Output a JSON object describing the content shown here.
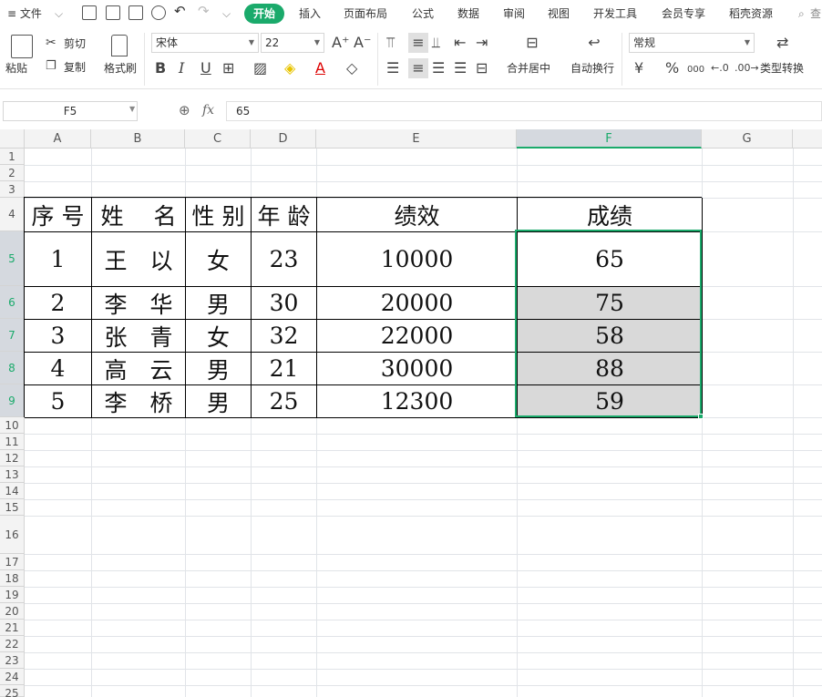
{
  "menubar": {
    "file_menu": "≡ 文件",
    "tabs": [
      "开始",
      "插入",
      "页面布局",
      "公式",
      "数据",
      "审阅",
      "视图",
      "开发工具",
      "会员专享",
      "稻壳资源"
    ],
    "search_hint": "查"
  },
  "ribbon": {
    "paste": "粘贴",
    "cut": "剪切",
    "copy": "复制",
    "format_painter": "格式刷",
    "font_name": "宋体",
    "font_size": "22",
    "bold": "B",
    "italic": "I",
    "underline": "U",
    "merge_center": "合并居中",
    "wrap_text": "自动换行",
    "number_format": "常规",
    "currency": "¥",
    "percent": "%",
    "thousands": "000",
    "type_convert": "类型转换"
  },
  "formula_bar": {
    "cell_ref": "F5",
    "fx": "fx",
    "value": "65"
  },
  "columns": [
    "A",
    "B",
    "C",
    "D",
    "E",
    "F",
    "G"
  ],
  "rows": [
    "1",
    "2",
    "3",
    "4",
    "5",
    "6",
    "7",
    "8",
    "9",
    "10",
    "11",
    "12",
    "13",
    "14",
    "15",
    "16",
    "17",
    "18",
    "19",
    "20",
    "21",
    "22",
    "23",
    "24",
    "25"
  ],
  "table": {
    "headers": [
      "序 号",
      "姓　 名",
      "性 别",
      "年 龄",
      "绩效",
      "成绩"
    ],
    "rows": [
      [
        "1",
        "王　以",
        "女",
        "23",
        "10000",
        "65"
      ],
      [
        "2",
        "李　华",
        "男",
        "30",
        "20000",
        "75"
      ],
      [
        "3",
        "张　青",
        "女",
        "32",
        "22000",
        "58"
      ],
      [
        "4",
        "高　云",
        "男",
        "21",
        "30000",
        "88"
      ],
      [
        "5",
        "李　桥",
        "男",
        "25",
        "12300",
        "59"
      ]
    ]
  },
  "colors": {
    "accent": "#1aaa6b",
    "selection_fill": "#d9d9d9"
  }
}
